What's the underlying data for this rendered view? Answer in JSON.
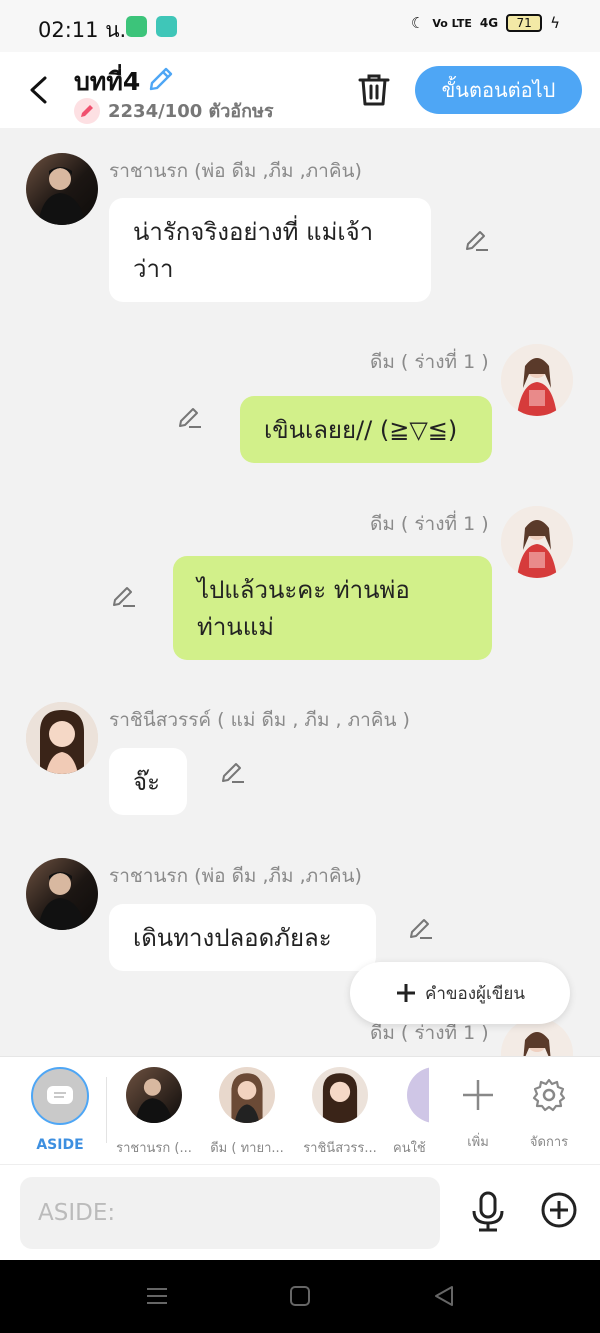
{
  "status": {
    "time": "02:11 น.",
    "network": "4G",
    "volte": "Vo LTE",
    "battery": "71"
  },
  "header": {
    "title": "บทที่4",
    "char_count": "2234/100 ตัวอักษร",
    "next_label": "ขั้นตอนต่อไป"
  },
  "messages": [
    {
      "name": "ราชานรก (พ่อ ดีม ,ภีม ,ภาคิน)",
      "text_l1": "น่ารักจริงอย่างที่ แม่เจ้า",
      "text_l2": "ว่าา"
    },
    {
      "name": "ดีม ( ร่างที่ 1 )",
      "text_l1": "เขินเลยย// (≧▽≦)"
    },
    {
      "name": "ดีม ( ร่างที่ 1 )",
      "text_l1": "ไปแล้วนะคะ ท่านพ่อ",
      "text_l2": "ท่านแม่"
    },
    {
      "name": "ราชินีสวรรค์ ( แม่ ดีม , ภีม , ภาคิน )",
      "text_l1": "จ๊ะ"
    },
    {
      "name": "ราชานรก (พ่อ ดีม ,ภีม ,ภาคิน)",
      "text_l1": "เดินทางปลอดภัยละ"
    },
    {
      "name": "ดีม ( ร่างที่ 1 )"
    }
  ],
  "author_note": {
    "label": "คำของผู้เขียน"
  },
  "characters": {
    "aside": "ASIDE",
    "items": [
      {
        "label": "ราชานรก (..."
      },
      {
        "label": "ดีม ( ทายา..."
      },
      {
        "label": "ราชินีสวรร..."
      },
      {
        "label": "คนใช้"
      }
    ],
    "add_label": "เพิ่ม",
    "manage_label": "จัดการ"
  },
  "input": {
    "placeholder": "ASIDE:"
  },
  "colors": {
    "accent": "#4ea6f5",
    "green_bubble": "#d2f08a",
    "background": "#f2f2f2"
  }
}
